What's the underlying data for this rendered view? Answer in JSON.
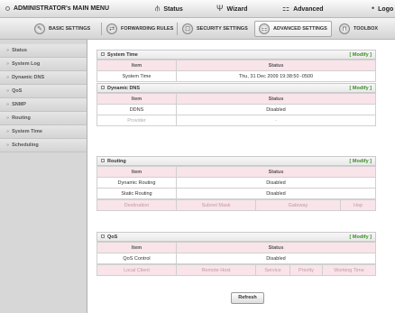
{
  "topbar": {
    "title": "ADMINISTRATOR's MAIN MENU",
    "items": [
      {
        "label": "Status",
        "icon": "antenna-icon"
      },
      {
        "label": "Wizard",
        "icon": "wand-icon"
      },
      {
        "label": "Advanced",
        "icon": "router-icon"
      },
      {
        "label": "Logo",
        "icon": "logout-icon"
      }
    ]
  },
  "tabs": [
    {
      "label": "BASIC SETTINGS",
      "icon": "wrench-icon",
      "active": false
    },
    {
      "label": "FORWARDING RULES",
      "icon": "arrows-icon",
      "active": false
    },
    {
      "label": "SECURITY SETTINGS",
      "icon": "lock-icon",
      "active": false
    },
    {
      "label": "ADVANCED SETTINGS",
      "icon": "router-icon",
      "active": true
    },
    {
      "label": "TOOLBOX",
      "icon": "toolbox-icon",
      "active": false
    }
  ],
  "sidebar": {
    "items": [
      {
        "label": "Status"
      },
      {
        "label": "System Log"
      },
      {
        "label": "Dynamic DNS"
      },
      {
        "label": "QoS"
      },
      {
        "label": "SNMP"
      },
      {
        "label": "Routing"
      },
      {
        "label": "System Time"
      },
      {
        "label": "Scheduling"
      }
    ]
  },
  "modify_label": "[ Modify ]",
  "system_time": {
    "title": "System Time",
    "header": [
      "Item",
      "Status"
    ],
    "rows": [
      [
        "System Time",
        "Thu, 31 Dec 2009 19:38:50 -0500"
      ]
    ]
  },
  "ddns": {
    "title": "Dynamic DNS",
    "header": [
      "Item",
      "Status"
    ],
    "rows": [
      [
        "DDNS",
        "Disabled"
      ],
      [
        "Provider",
        "-"
      ]
    ]
  },
  "routing": {
    "title": "Routing",
    "header": [
      "Item",
      "Status"
    ],
    "rows": [
      [
        "Dynamic Routing",
        "Disabled"
      ],
      [
        "Static Routing",
        "Disabled"
      ]
    ],
    "columns": [
      "Destination",
      "Subnet Mask",
      "Gateway",
      "Hop"
    ]
  },
  "qos": {
    "title": "QoS",
    "header": [
      "Item",
      "Status"
    ],
    "rows": [
      [
        "QoS Control",
        "Disabled"
      ]
    ],
    "columns": [
      "Local Client",
      "Remote Host",
      "Service",
      "Priority",
      "Working Time"
    ]
  },
  "refresh_label": "Refresh"
}
